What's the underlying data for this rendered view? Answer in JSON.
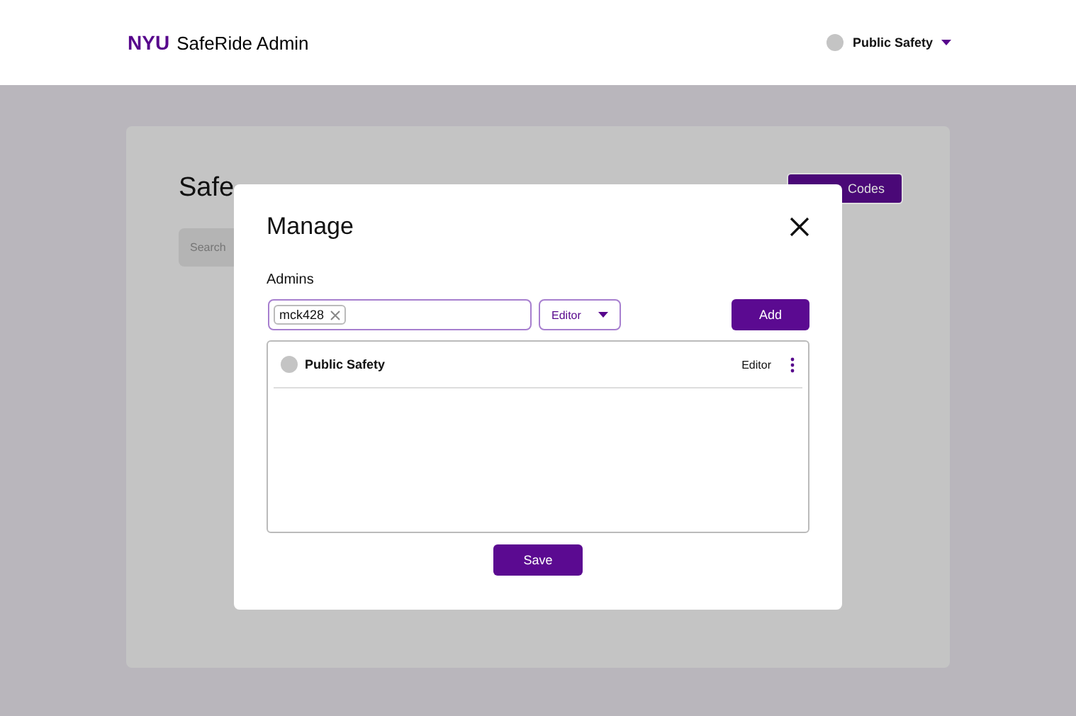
{
  "header": {
    "brand": "NYU",
    "title": "SafeRide Admin",
    "user": "Public Safety"
  },
  "page": {
    "title": "Safe",
    "upload_button": "Codes",
    "search": {
      "placeholder": "Search"
    }
  },
  "modal": {
    "title": "Manage",
    "section_label": "Admins",
    "input_chips": [
      "mck428"
    ],
    "role_select": "Editor",
    "add_button": "Add",
    "admins": [
      {
        "name": "Public Safety",
        "role": "Editor"
      }
    ],
    "save_button": "Save"
  }
}
